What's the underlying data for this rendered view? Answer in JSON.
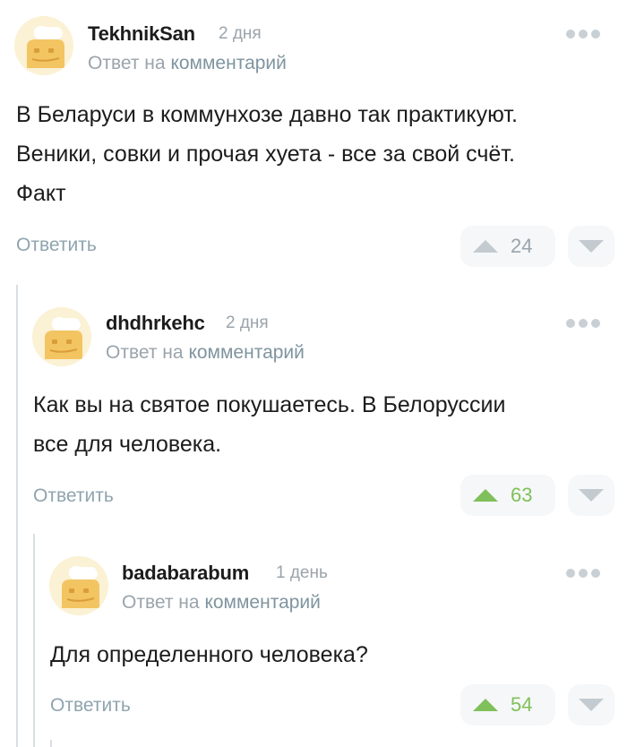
{
  "comments": [
    {
      "username": "TekhnikSan",
      "time": "2 дня",
      "reply_prefix": "Ответ на",
      "reply_link": "комментарий",
      "text_lines": [
        "В Беларуси в коммунхозе давно так практикуют.",
        "Веники, совки и прочая хуета - все за свой счёт.",
        "Факт"
      ],
      "reply_label": "Ответить",
      "rating": "24",
      "positive": false
    },
    {
      "username": "dhdhrkehc",
      "time": "2 дня",
      "reply_prefix": "Ответ на",
      "reply_link": "комментарий",
      "text_lines": [
        "Как вы на святое покушаетесь. В Белоруссии",
        "все для человека."
      ],
      "reply_label": "Ответить",
      "rating": "63",
      "positive": true
    },
    {
      "username": "badabarabum",
      "time": "1 день",
      "reply_prefix": "Ответ на",
      "reply_link": "комментарий",
      "text_lines": [
        "Для определенного человека?"
      ],
      "reply_label": "Ответить",
      "rating": "54",
      "positive": true
    }
  ],
  "colors": {
    "positive": "#7fc05a",
    "muted": "#9aa4ab",
    "thread_line": "#d9dee2"
  },
  "icons": {
    "avatar": "default-avatar-icon",
    "more": "more-dots-icon",
    "upvote": "upvote-icon",
    "downvote": "downvote-icon"
  }
}
